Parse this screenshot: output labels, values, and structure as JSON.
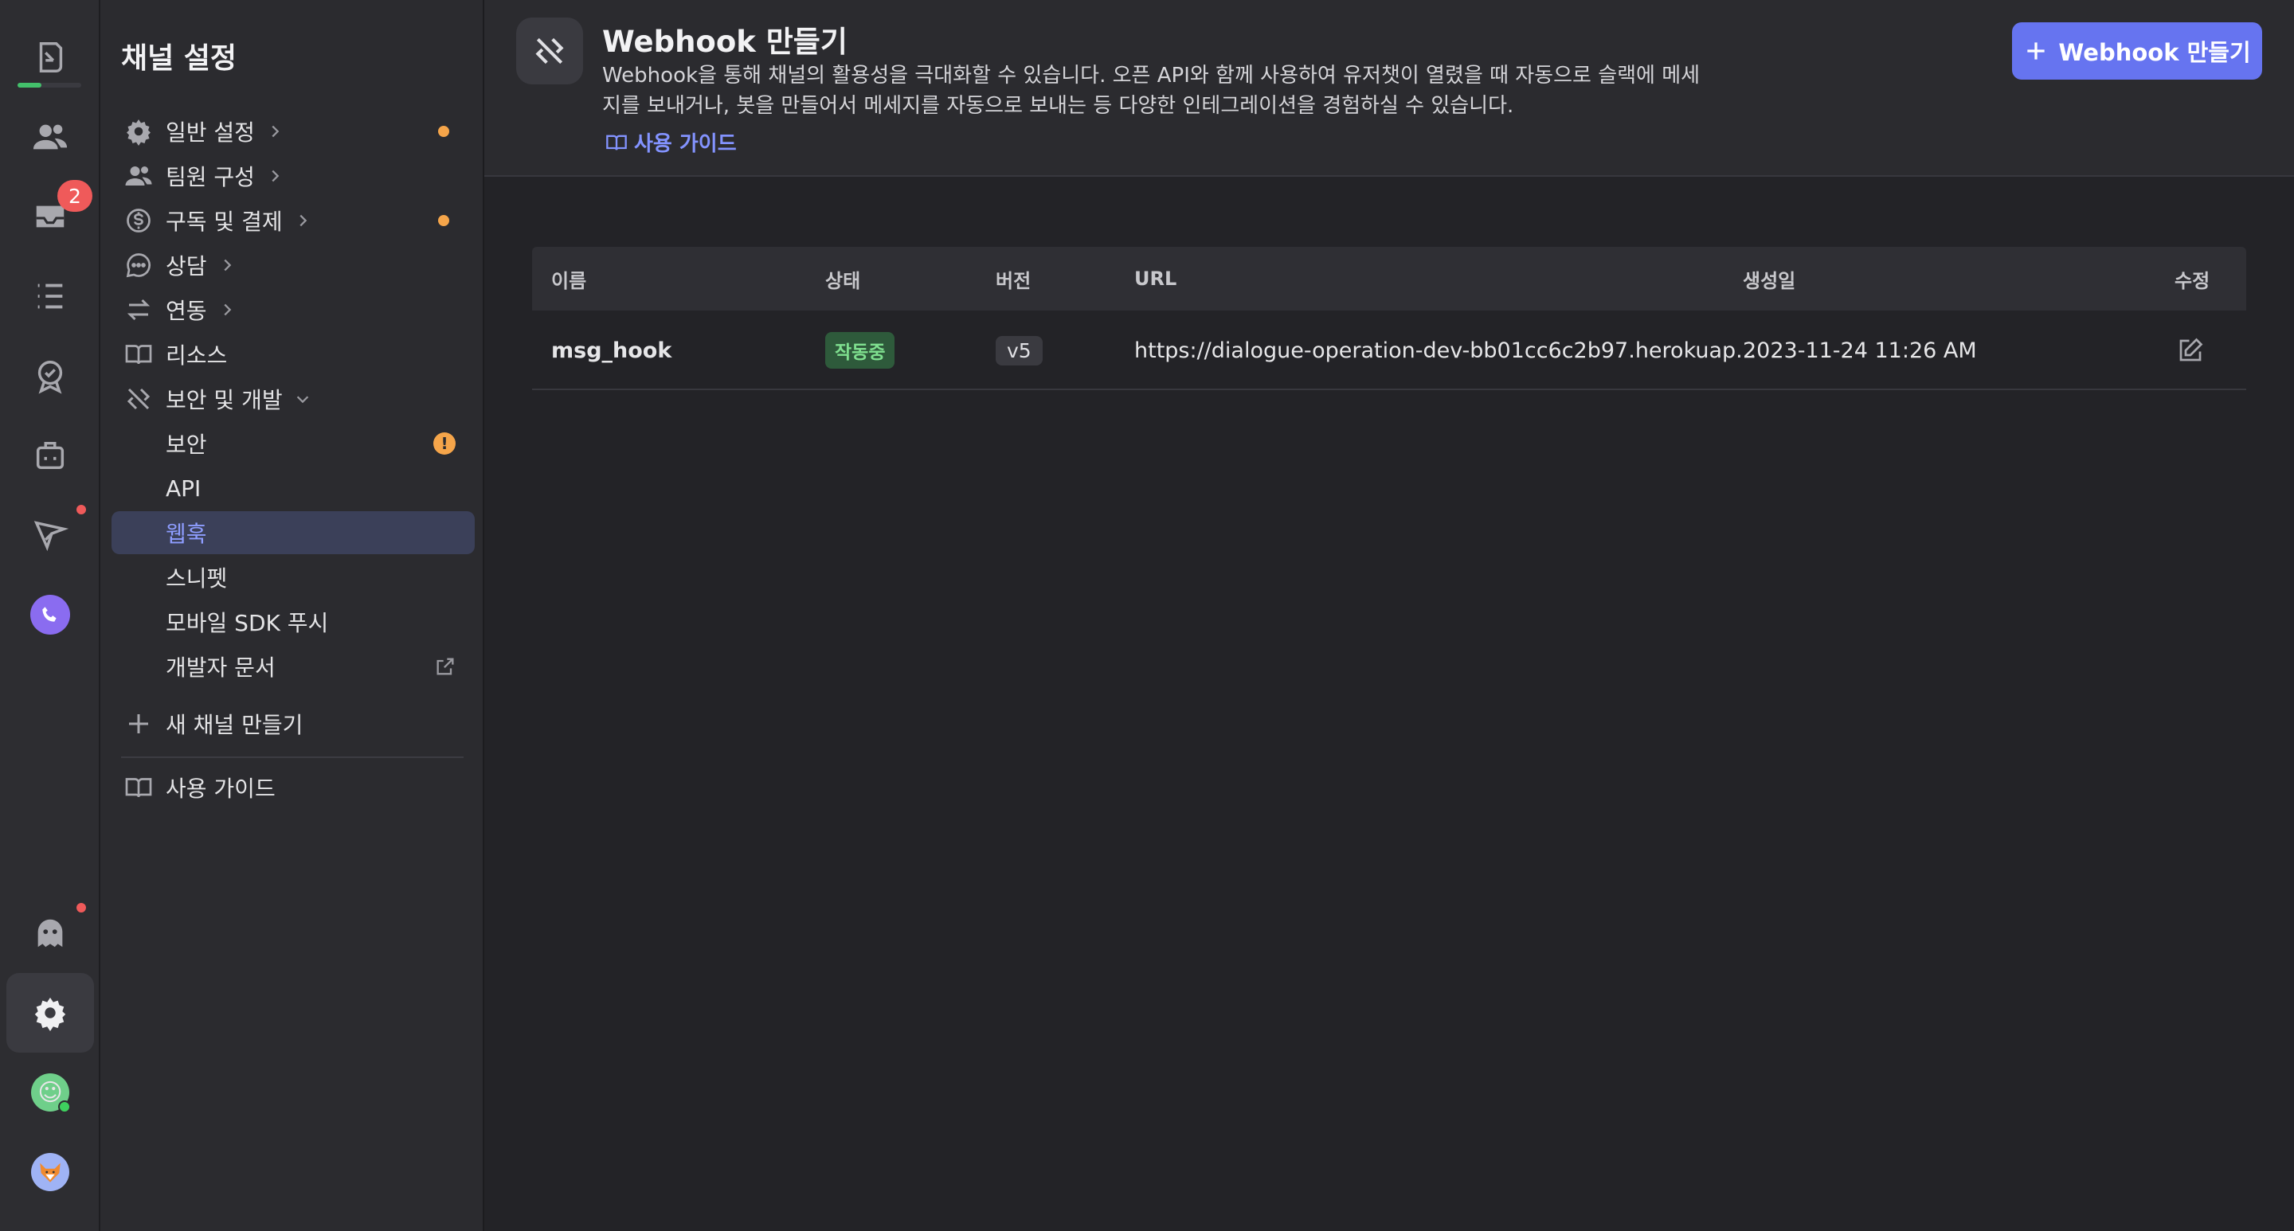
{
  "rail": {
    "inbox_badge": "2",
    "items": [
      "team-chat-icon",
      "people-icon",
      "inbox-icon",
      "list-icon",
      "badge-check-icon",
      "bot-icon",
      "send-icon",
      "phone-icon",
      "ghost-icon",
      "settings-icon",
      "user-avatar",
      "fox-avatar"
    ]
  },
  "sidebar": {
    "title": "채널 설정",
    "items": [
      {
        "label": "일반 설정",
        "icon": "gear-icon"
      },
      {
        "label": "팀원 구성",
        "icon": "people-icon"
      },
      {
        "label": "구독 및 결제",
        "icon": "dollar-icon"
      },
      {
        "label": "상담",
        "icon": "chat-icon"
      },
      {
        "label": "연동",
        "icon": "swap-icon"
      },
      {
        "label": "리소스",
        "icon": "book-icon"
      },
      {
        "label": "보안 및 개발",
        "icon": "tools-icon"
      }
    ],
    "sub_items": [
      {
        "label": "보안"
      },
      {
        "label": "API"
      },
      {
        "label": "웹훅"
      },
      {
        "label": "스니펫"
      },
      {
        "label": "모바일 SDK 푸시"
      },
      {
        "label": "개발자 문서"
      }
    ],
    "warn_symbol": "!",
    "new_channel": "새 채널 만들기",
    "guide": "사용 가이드"
  },
  "header": {
    "title": "Webhook 만들기",
    "description": "Webhook을 통해 채널의 활용성을 극대화할 수 있습니다. 오픈 API와 함께 사용하여 유저챗이 열렸을 때 자동으로 슬랙에 메세지를 보내거나, 봇을 만들어서 메세지를 자동으로 보내는 등 다양한 인테그레이션을 경험하실 수 있습니다.",
    "guide_link": "사용 가이드",
    "create_button": "Webhook 만들기"
  },
  "table": {
    "columns": [
      "이름",
      "상태",
      "버전",
      "URL",
      "생성일",
      "수정"
    ],
    "rows": [
      {
        "name": "msg_hook",
        "status": "작동중",
        "version": "v5",
        "url": "https://dialogue-operation-dev-bb01cc6c2b97.herokuap...",
        "created": "2023-11-24 11:26 AM"
      }
    ]
  },
  "colors": {
    "accent": "#6674f0",
    "active_item_bg": "#3b4059",
    "status_green": "#7fe08f",
    "notify_orange": "#f5a54a",
    "badge_red": "#ef5a5a"
  }
}
